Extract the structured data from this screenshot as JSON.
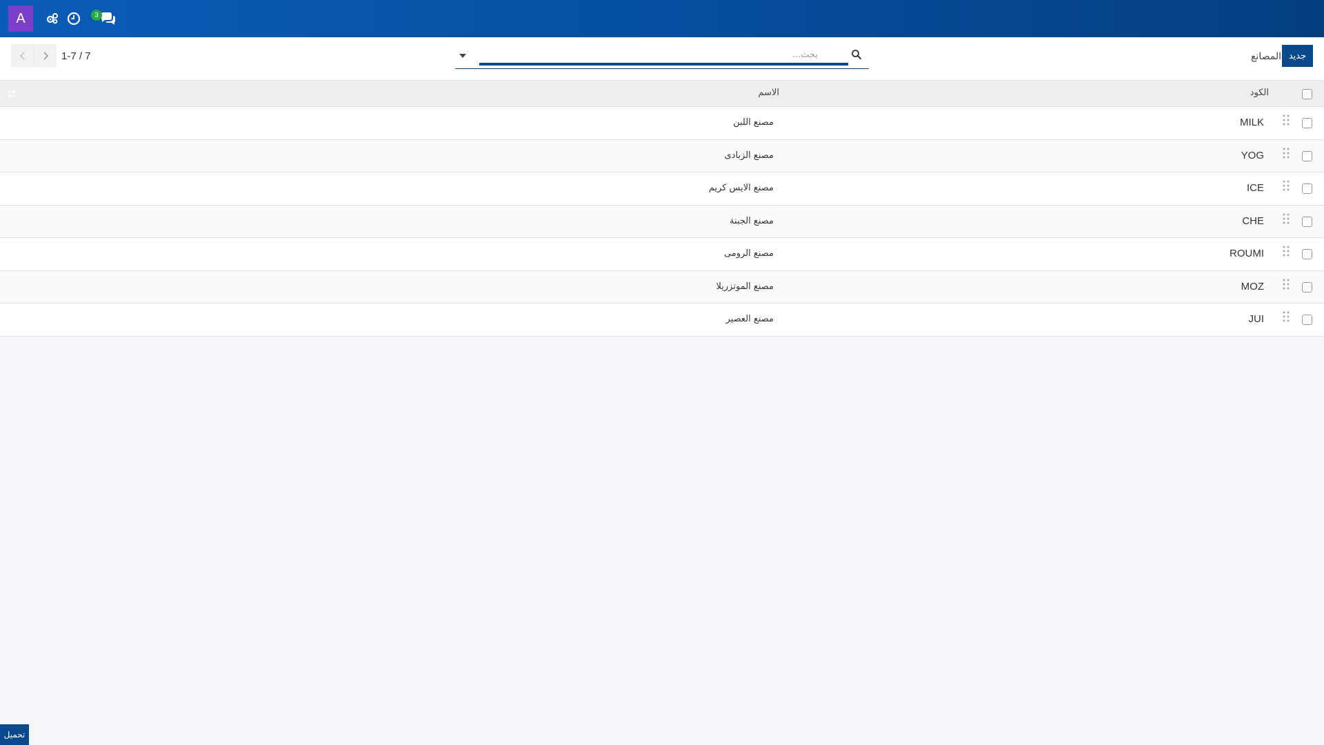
{
  "navbar": {
    "avatar_letter": "A",
    "messages_count": "3",
    "icons": [
      "settings-cogs-icon",
      "clock-icon",
      "chat-icon"
    ]
  },
  "control": {
    "new_label": "جديد",
    "breadcrumb": "المصانع",
    "search_placeholder": "بحث...",
    "pager": "1-7 / 7"
  },
  "table": {
    "headers": {
      "code": "الكود",
      "name": "الاسم"
    },
    "rows": [
      {
        "code": "MILK",
        "name": "مصنع اللبن"
      },
      {
        "code": "YOG",
        "name": "مصنع الزبادى"
      },
      {
        "code": "ICE",
        "name": "مصنع الايس كريم"
      },
      {
        "code": "CHE",
        "name": "مصنع الجبنة"
      },
      {
        "code": "ROUMI",
        "name": "مصنع الرومى"
      },
      {
        "code": "MOZ",
        "name": "مصنع الموتزريلا"
      },
      {
        "code": "JUI",
        "name": "مصنع العصير"
      }
    ]
  },
  "footer": {
    "load_label": "تحميل"
  },
  "colors": {
    "navbar": "#064fa0",
    "primary": "#0a4a8c",
    "avatar": "#7b3fc9",
    "badge": "#28a745"
  }
}
